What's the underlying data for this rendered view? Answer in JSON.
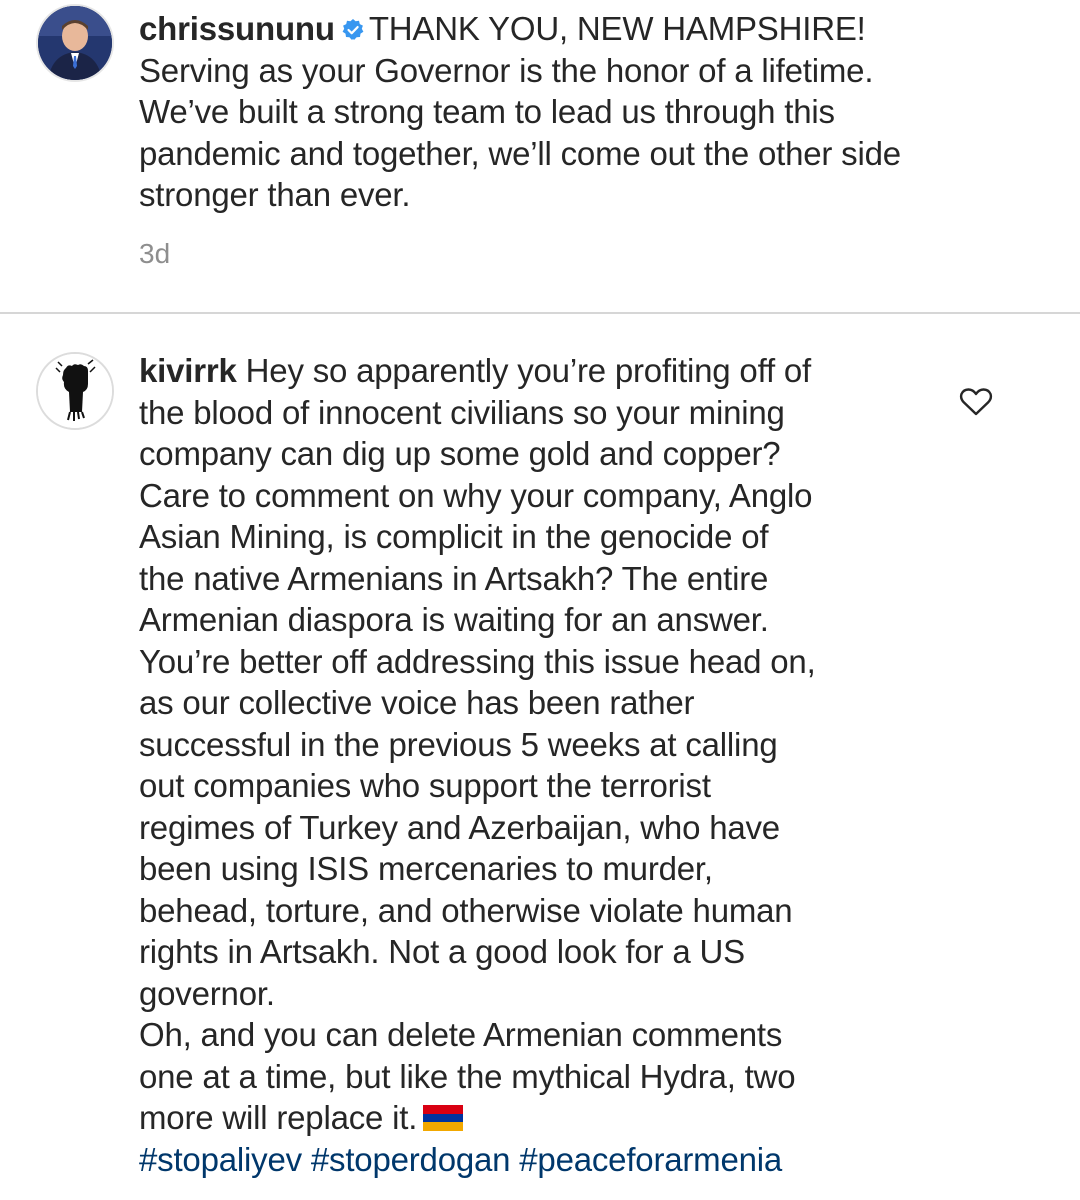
{
  "post": {
    "username": "chrissununu",
    "verified_icon": "verified-badge-icon",
    "caption_lines": [
      "THANK YOU, NEW HAMPSHIRE!",
      "Serving as your Governor is the honor of a lifetime.",
      "We’ve built a strong team to lead us through this",
      "pandemic and together, we’ll come out the other side",
      "stronger than ever."
    ],
    "timestamp": "3d"
  },
  "comment": {
    "username": "kivirrk",
    "lines": [
      "Hey so apparently you’re profiting off of",
      "the blood of innocent civilians so your mining",
      "company can dig up some gold and copper?",
      "Care to comment on why your company, Anglo",
      "Asian Mining, is complicit in the genocide of",
      "the native Armenians in Artsakh? The entire",
      "Armenian diaspora is waiting for an answer.",
      "You’re better off addressing this issue head on,",
      "as our collective voice has been rather",
      "successful in the previous 5 weeks at calling",
      "out companies who support the terrorist",
      "regimes of Turkey and Azerbaijan, who have",
      "been using ISIS mercenaries to murder,",
      "behead, torture, and otherwise violate human",
      "rights in Artsakh. Not a good look for a US",
      "governor.",
      "Oh, and you can delete Armenian comments",
      "one at a time, but like the mythical Hydra, two",
      "more will replace it."
    ],
    "hashtags": "#stopaliyev #stoperdogan #peaceforarmenia",
    "like_icon": "heart-icon",
    "flag_icon": "armenian-flag-emoji"
  },
  "colors": {
    "text": "#262626",
    "muted": "#8e8e8e",
    "hashtag": "#00376b",
    "verified": "#3897f0",
    "flag_red": "#d90012",
    "flag_blue": "#0033a0",
    "flag_orange": "#f2a800"
  }
}
